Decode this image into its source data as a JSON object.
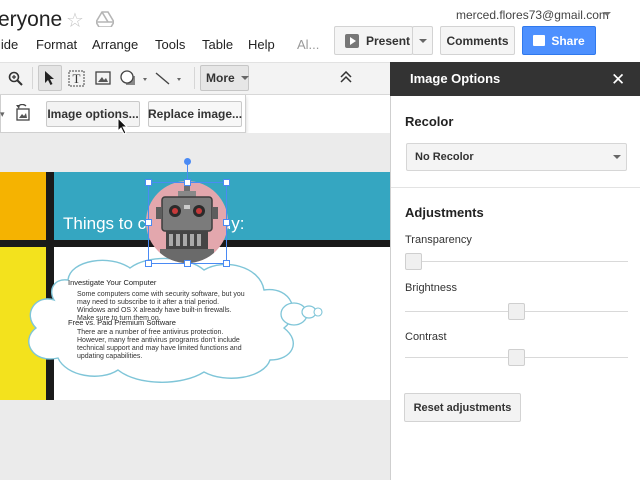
{
  "header": {
    "doc_title": "eryone",
    "star_icon": "star-icon",
    "drive_icon": "drive-icon",
    "account_email": "merced.flores73@gmail.com"
  },
  "menu": {
    "items": [
      "lide",
      "Format",
      "Arrange",
      "Tools",
      "Table",
      "Help",
      "Al..."
    ]
  },
  "buttons": {
    "present": "Present",
    "comments": "Comments",
    "share": "Share"
  },
  "toolbar": {
    "tools": [
      "zoom-icon",
      "select-icon",
      "text-box-icon",
      "image-icon",
      "shape-icon",
      "line-icon"
    ],
    "more_label": "More",
    "collapse_icon": "chevron-double-up-icon"
  },
  "more_popup": {
    "image_options_label": "Image options...",
    "replace_image_label": "Replace image..."
  },
  "slide": {
    "heading": "Things to co     re you buy:",
    "cloud": {
      "heading1": "Investigate Your Computer",
      "para1": "Some computers come with security software, but you may need to subscribe to it after a trial period. Windows and OS X already have built-in firewalls. Make sure to turn them on.",
      "heading2": "Free vs. Paid Premium Software",
      "para2": "There are a number of free antivirus protection. However, many free antivirus programs don't include technical support and may have limited functions and updating capabilities."
    },
    "colors": {
      "orange": "#f5b301",
      "teal": "#35a6c1",
      "yellow": "#f3e21d",
      "black": "#1a1a1a",
      "cloud_stroke": "#7fc5d8"
    }
  },
  "sidebar": {
    "title": "Image Options",
    "close_icon": "close-icon",
    "recolor": {
      "title": "Recolor",
      "selected": "No Recolor"
    },
    "adjustments": {
      "title": "Adjustments",
      "sliders": [
        {
          "label": "Transparency",
          "value": 0.0
        },
        {
          "label": "Brightness",
          "value": 0.5
        },
        {
          "label": "Contrast",
          "value": 0.5
        }
      ]
    },
    "reset_label": "Reset adjustments"
  },
  "colors": {
    "share_blue": "#4d90fe",
    "selection_blue": "#4a8af4",
    "sidebar_header": "#333333"
  }
}
